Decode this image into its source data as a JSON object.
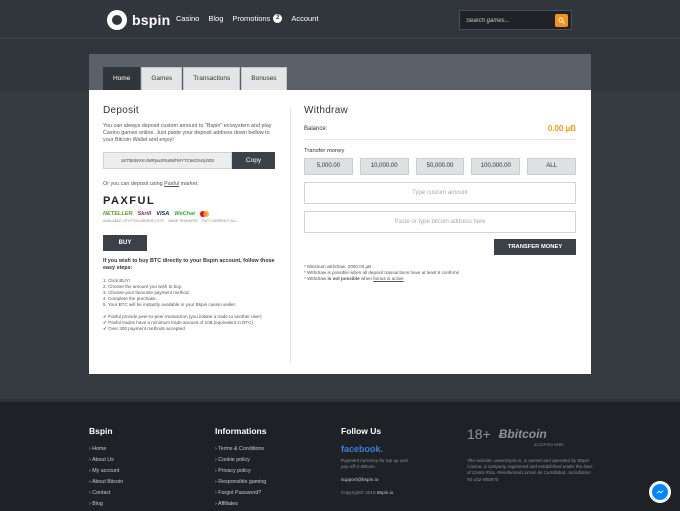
{
  "header": {
    "logo_text": "bspin",
    "nav": [
      {
        "label": "Casino"
      },
      {
        "label": "Blog"
      },
      {
        "label": "Promotions",
        "badge": "2"
      },
      {
        "label": "Account"
      }
    ],
    "search_placeholder": "Search games...",
    "accent_color": "#f7931a"
  },
  "tabs": [
    "Home",
    "Games",
    "Transactions",
    "Bonuses"
  ],
  "deposit": {
    "title": "Deposit",
    "description": "You can always deposit custom amount to \"Bspin\" ecosystem and play Casino games online. Just paste your deposit address down bellow to your Bitcoin Wallet and enjoy!",
    "address": "1KTBdWXmJMRpw2RuBdFMYTC6KDr4rjXBS",
    "copy_label": "Copy",
    "alt_prefix": "Or you can deposit using",
    "alt_link": "Paxful",
    "alt_suffix": "market.",
    "paxful_logo": "PAXFUL",
    "payment_logos": [
      "NETELLER",
      "Skrill",
      "VISA",
      "WeChat"
    ],
    "payment_captions": [
      "AVAILABLE CRYPTOCURRENCY ETC",
      "BANK TRANSFER",
      "FIAT CURRENCY ALL"
    ],
    "buy_label": "BUY",
    "if_want": "If you wish to buy BTC directly to your Bspin account, follow those easy steps:",
    "steps": [
      "1. Click BUY!",
      "2. Choose the amount you wish to buy.",
      "3. Choose your favourite payment method.",
      "4. Complete the purchase.",
      "5. Your BTC will be instantly available in your Bspin casino wallet."
    ],
    "notes": [
      "Paxful provide peer-to-peer transaction (you initiate a trade to another user)",
      "Paxful trades have a minimum trade amount of 10$ (equivalent in BTC)",
      "Over 300 payment methods accepted"
    ]
  },
  "withdraw": {
    "title": "Withdraw",
    "balance_label": "Balance:",
    "balance_value": "0.00 µB",
    "transfer_money_label": "Transfer money",
    "amounts": [
      "5,000.00",
      "10,000.00",
      "50,000.00",
      "100,000.00",
      "ALL"
    ],
    "amount_placeholder": "Type custom amount",
    "address_placeholder": "Paste or type bitcoin address here",
    "transfer_label": "TRANSFER MONEY",
    "notes_1": "* Minimum withdraw: 2000.00 µB",
    "notes_2": "* Withdraw is possible when all deposit transactions have at least 6 confirms",
    "notes_3_prefix": "* Withdraw",
    "notes_3_bold": "is not possible",
    "notes_3_mid": "when",
    "notes_3_link": "bonus is active"
  },
  "footer": {
    "bspin_title": "Bspin",
    "bspin_links": [
      "Home",
      "About Us",
      "My account",
      "About Bitcoin",
      "Contact",
      "Blog"
    ],
    "info_title": "Informations",
    "info_links": [
      "Terms & Conditions",
      "Cookie policy",
      "Privacy policy",
      "Responsible gaming",
      "Forgot Password?",
      "Affiliates"
    ],
    "follow_title": "Follow Us",
    "facebook": "facebook.",
    "follow_text": "Payment currency for top up and pay-off is Bitcoin.",
    "email": "support@bspin.io",
    "copyright_prefix": "Copyright© 2018",
    "copyright_brand": "Bspin.io",
    "age": "18+",
    "bitcoin": "bitcoin",
    "bitcoin_sub": "ACCEPTED HERE",
    "legal_text": "The website, www.bspin.io, is owned and operated by Bspin Casino, a company registered and established under the laws of Costa Rica, Residencial Lomas de Curridabat, Jurisdiction #3-102-680870"
  }
}
